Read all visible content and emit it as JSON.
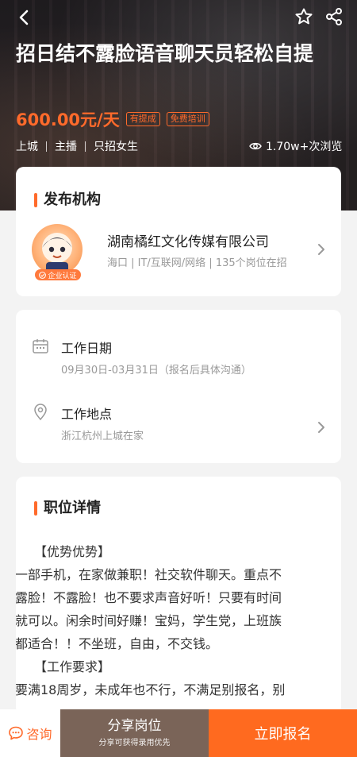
{
  "hero": {
    "title": "招日结不露脸语音聊天员轻松自提",
    "salary": "600.00元/天",
    "tags": [
      "有提成",
      "免费培训"
    ],
    "meta": [
      "上城",
      "主播",
      "只招女生"
    ],
    "views": "1.70w+次浏览"
  },
  "publisher": {
    "section_title": "发布机构",
    "org_name": "湖南橘红文化传媒有限公司",
    "org_info": "海口 | IT/互联网/网络 | 135个岗位在招",
    "badge": "企业认证"
  },
  "work": {
    "date_label": "工作日期",
    "date_value": "09月30日-03月31日（报名后具体沟通）",
    "location_label": "工作地点",
    "location_value": "浙江杭州上城在家"
  },
  "details": {
    "section_title": "职位详情",
    "lines": [
      "【优势优势】",
      "一部手机，在家做兼职！社交软件聊天。重点不",
      "露脸！不露脸！也不要求声音好听！只要有时间",
      "就可以。闲余时间好赚！宝妈，学生党，上班族",
      "都适合！！不坐班，自由，不交钱。",
      "【工作要求】",
      "要满18周岁，未成年也不行，不满足别报名，别"
    ]
  },
  "bottom": {
    "consult": "咨询",
    "share_main": "分享岗位",
    "share_sub": "分享可获得录用优先",
    "apply": "立即报名"
  },
  "colors": {
    "accent": "#ff6a2b",
    "apply_bg": "#ff6a1f",
    "share_bg": "#7a6458"
  }
}
